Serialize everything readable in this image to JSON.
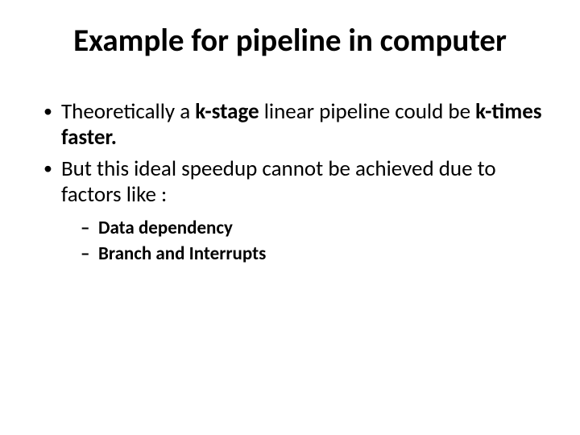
{
  "title": "Example for pipeline in computer",
  "bullets": {
    "b1_pre": "Theoretically a ",
    "b1_bold1": "k-stage",
    "b1_mid": " linear pipeline could be ",
    "b1_bold2": "k-times faster.",
    "b2": "But this ideal speedup cannot be achieved due to factors like :",
    "sub1": "Data dependency",
    "sub2": "Branch and Interrupts"
  }
}
